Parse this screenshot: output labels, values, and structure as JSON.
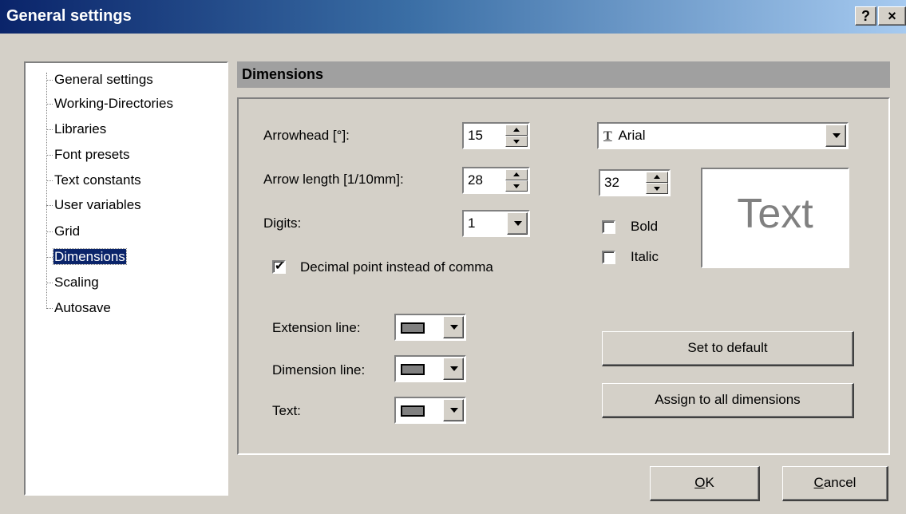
{
  "window": {
    "title": "General settings",
    "help_label": "?",
    "close_label": "×"
  },
  "tree": {
    "items": [
      {
        "label": "General settings",
        "selected": false
      },
      {
        "label": "Working-Directories",
        "selected": false
      },
      {
        "label": "Libraries",
        "selected": false
      },
      {
        "label": "Font presets",
        "selected": false
      },
      {
        "label": "Text constants",
        "selected": false
      },
      {
        "label": "User variables",
        "selected": false
      },
      {
        "label": "Grid",
        "selected": false
      },
      {
        "label": "Dimensions",
        "selected": true
      },
      {
        "label": "Scaling",
        "selected": false
      },
      {
        "label": "Autosave",
        "selected": false
      }
    ]
  },
  "panel": {
    "title": "Dimensions",
    "arrowhead": {
      "label": "Arrowhead [°]:",
      "value": "15"
    },
    "arrow_length": {
      "label": "Arrow length [1/10mm]:",
      "value": "28"
    },
    "digits": {
      "label": "Digits:",
      "value": "1"
    },
    "decimal_point": {
      "label": "Decimal point instead of comma",
      "checked": true
    },
    "extension_line": {
      "label": "Extension line:",
      "color": "#808080"
    },
    "dimension_line": {
      "label": "Dimension line:",
      "color": "#808080"
    },
    "text_color": {
      "label": "Text:",
      "color": "#808080"
    },
    "font": {
      "icon": "truetype-font-icon",
      "glyph": "T",
      "name": "Arial"
    },
    "font_size": "32",
    "bold": {
      "label": "Bold",
      "checked": false
    },
    "italic": {
      "label": "Italic",
      "checked": false
    },
    "preview_text": "Text",
    "set_default_label": "Set to default",
    "assign_all_label": "Assign to all dimensions"
  },
  "footer": {
    "ok_mnemonic": "O",
    "ok_rest": "K",
    "cancel_mnemonic": "C",
    "cancel_rest": "ancel"
  }
}
